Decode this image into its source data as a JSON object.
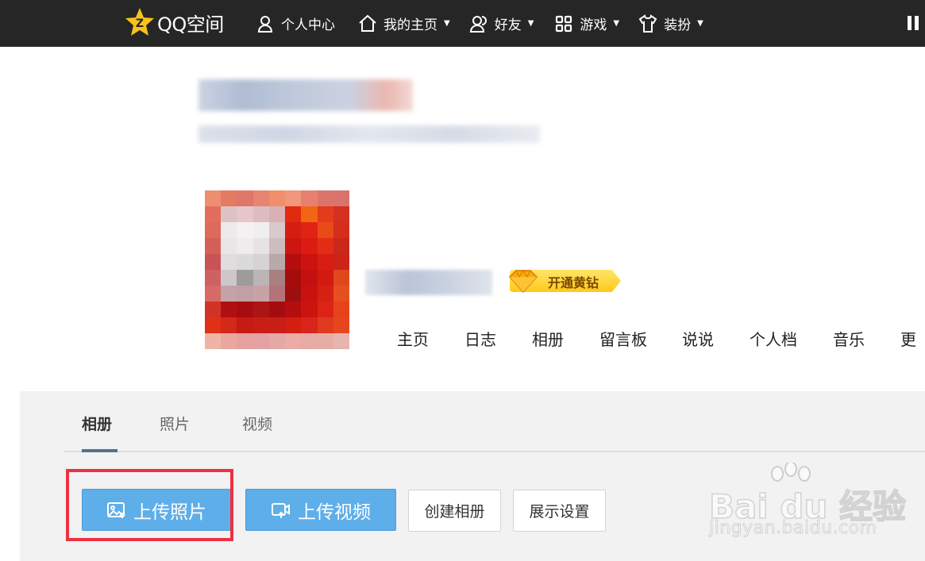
{
  "topbar": {
    "logo_text": "QQ空间",
    "nav": [
      {
        "label": "个人中心",
        "icon": "person-icon",
        "has_caret": false
      },
      {
        "label": "我的主页",
        "icon": "home-icon",
        "has_caret": true
      },
      {
        "label": "好友",
        "icon": "friends-icon",
        "has_caret": true
      },
      {
        "label": "游戏",
        "icon": "grid-icon",
        "has_caret": true
      },
      {
        "label": "装扮",
        "icon": "tshirt-icon",
        "has_caret": true
      }
    ],
    "caret": "▼"
  },
  "profile": {
    "vip_badge_label": "开通黄钻",
    "tabs": [
      "主页",
      "日志",
      "相册",
      "留言板",
      "说说",
      "个人档",
      "音乐",
      "更"
    ]
  },
  "album": {
    "subtabs": [
      "相册",
      "照片",
      "视频"
    ],
    "active_subtab": "相册",
    "buttons": {
      "upload_photo": "上传照片",
      "upload_video": "上传视频",
      "create_album": "创建相册",
      "display_settings": "展示设置"
    }
  },
  "watermark": {
    "logo": "Bai du 经验",
    "sub": "jingyan.baidu.com"
  },
  "colors": {
    "topbar": "#262626",
    "upload_button": "#5eaeea",
    "highlight_box": "#ee3140",
    "active_tab_bar": "#54708f",
    "vip_badge": "#ffc81a"
  }
}
